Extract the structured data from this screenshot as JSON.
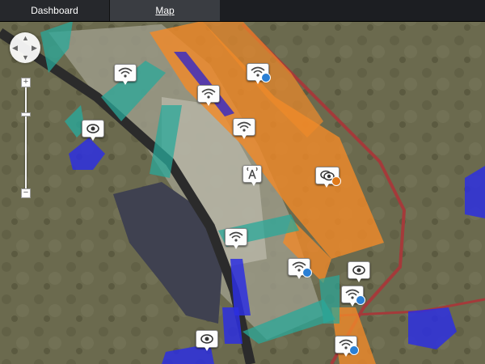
{
  "tabs": [
    {
      "label": "Dashboard",
      "active": false
    },
    {
      "label": "Map",
      "active": true
    }
  ],
  "map_controls": {
    "zoom_in_symbol": "+",
    "zoom_out_symbol": "−"
  },
  "markers": [
    {
      "type": "wifi-icon"
    },
    {
      "type": "wifi-camera-icon"
    },
    {
      "type": "wifi-icon"
    },
    {
      "type": "camera-icon"
    },
    {
      "type": "wifi-icon"
    },
    {
      "type": "radio-tower-icon"
    },
    {
      "type": "camera-stack-icon"
    },
    {
      "type": "wifi-icon"
    },
    {
      "type": "wifi-camera-icon"
    },
    {
      "type": "camera-icon"
    },
    {
      "type": "wifi-camera-icon"
    },
    {
      "type": "camera-icon"
    },
    {
      "type": "wifi-camera-icon"
    }
  ],
  "colors": {
    "zone_orange": "#f08a2a",
    "zone_teal": "#2aa89a",
    "zone_blue": "#2d2fe0",
    "road_red": "#a43a3a"
  }
}
